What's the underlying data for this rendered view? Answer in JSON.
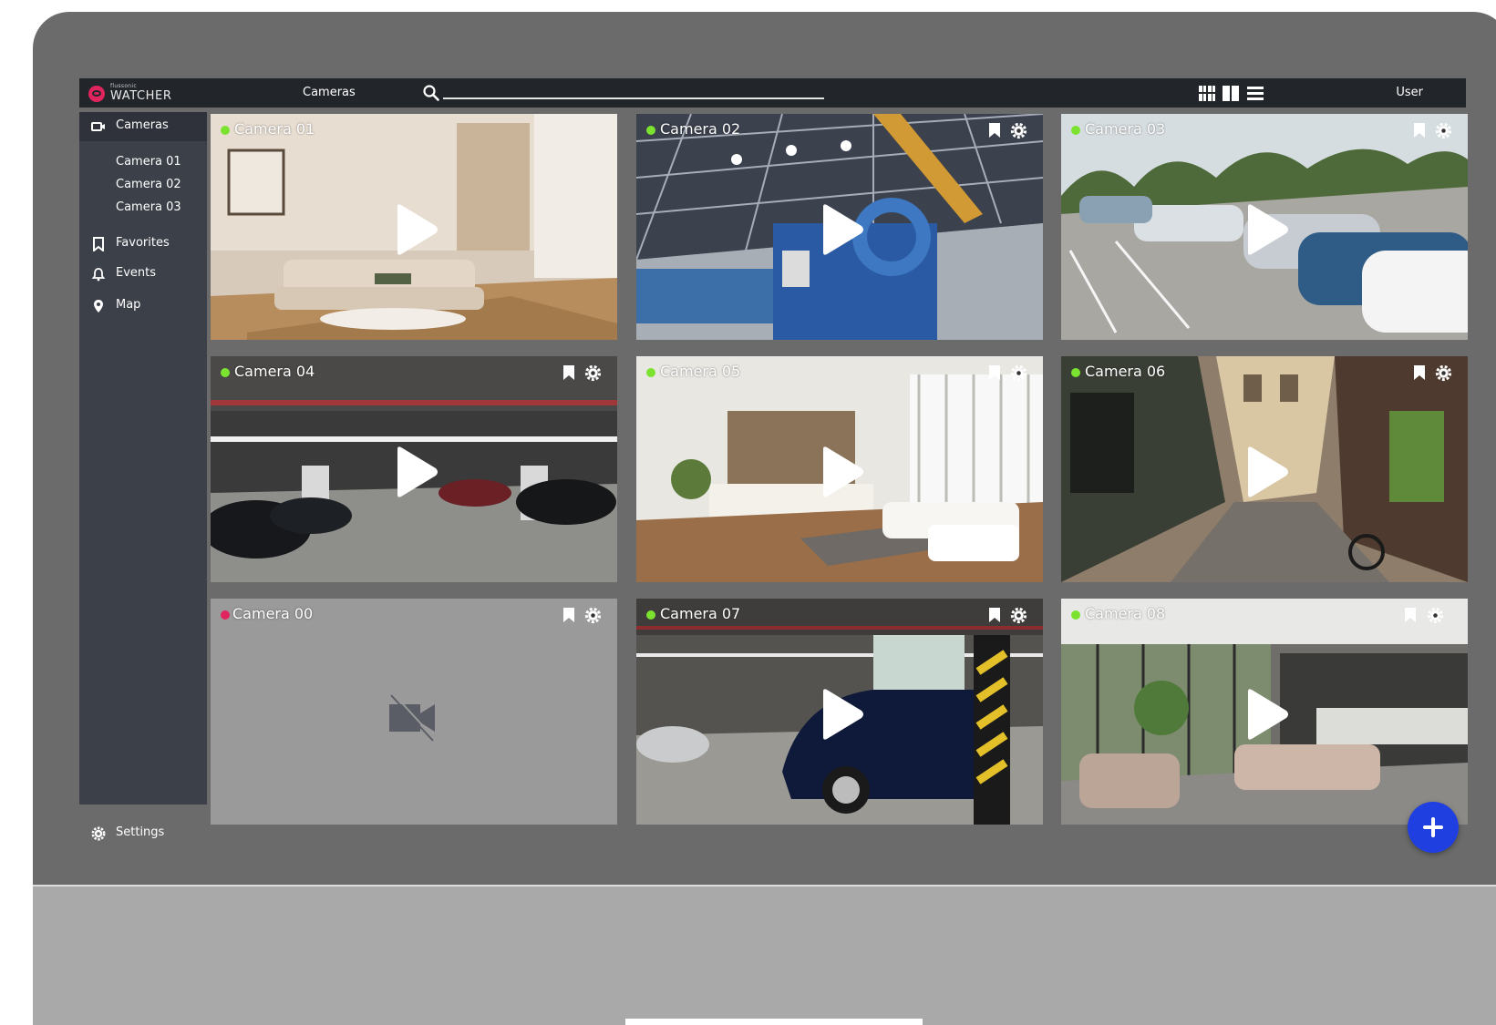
{
  "app": {
    "logo_small": "flussonic",
    "logo_big": "WATCHER",
    "brand_color": "#e0245e"
  },
  "topbar": {
    "section_label": "Cameras",
    "search": {
      "value": "",
      "icon": "search-icon"
    },
    "view_modes": [
      "grid-view-icon",
      "split-view-icon",
      "list-view-icon"
    ],
    "user_label": "User"
  },
  "sidebar": {
    "items": [
      {
        "label": "Cameras",
        "icon": "video-camera-icon",
        "active": true
      },
      {
        "label": "Favorites",
        "icon": "bookmark-icon"
      },
      {
        "label": "Events",
        "icon": "bell-icon"
      },
      {
        "label": "Map",
        "icon": "map-pin-icon"
      }
    ],
    "camera_links": [
      "Camera 01",
      "Camera 02",
      "Camera 03"
    ],
    "settings_label": "Settings"
  },
  "tiles": [
    {
      "title": "Camera 01",
      "status": "online",
      "scene": "living-room"
    },
    {
      "title": "Camera 02",
      "status": "online",
      "scene": "factory-hall"
    },
    {
      "title": "Camera 03",
      "status": "online",
      "scene": "parking-lot"
    },
    {
      "title": "Camera 04",
      "status": "online",
      "scene": "underground-garage"
    },
    {
      "title": "Camera 05",
      "status": "online",
      "scene": "bright-living-room"
    },
    {
      "title": "Camera 06",
      "status": "online",
      "scene": "old-street"
    },
    {
      "title": "Camera 00",
      "status": "offline",
      "scene": "no-signal"
    },
    {
      "title": "Camera 07",
      "status": "online",
      "scene": "garage-car"
    },
    {
      "title": "Camera 08",
      "status": "online",
      "scene": "open-plan-interior"
    }
  ],
  "colors": {
    "online": "#7be32f",
    "offline": "#e0245e",
    "fab": "#1f3fe0"
  },
  "fab_icon": "plus-icon"
}
